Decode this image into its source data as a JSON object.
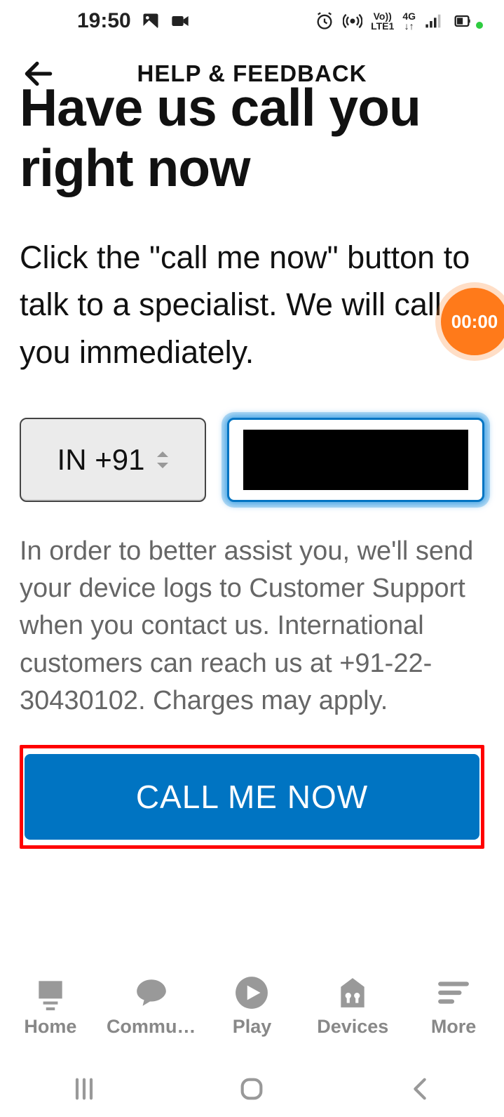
{
  "statusbar": {
    "time": "19:50",
    "net_label": "LTE1",
    "gen_label": "4G",
    "volte_label": "Vo))"
  },
  "appbar": {
    "title": "HELP & FEEDBACK"
  },
  "page": {
    "heading_line1": "Have us call you",
    "heading_line2": "right now",
    "subtitle": "Click the \"call me now\" button to talk to a specialist. We will call you immediately.",
    "country_code": "IN +91",
    "phone_value": "",
    "disclaimer": "In order to better assist you, we'll send your device logs to Customer Support when you contact us. International customers can reach us at +91-22-30430102. Charges may apply.",
    "cta_label": "CALL ME NOW"
  },
  "timer": {
    "value": "00:00"
  },
  "bottomnav": {
    "items": [
      {
        "label": "Home"
      },
      {
        "label": "Commu…"
      },
      {
        "label": "Play"
      },
      {
        "label": "Devices"
      },
      {
        "label": "More"
      }
    ]
  }
}
